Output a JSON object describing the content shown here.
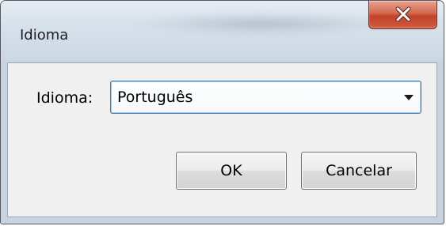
{
  "window": {
    "title": "Idioma",
    "close_icon": "close-x-icon"
  },
  "form": {
    "language_label": "Idioma:",
    "language_value": "Português",
    "dropdown_icon": "chevron-down-icon"
  },
  "buttons": {
    "ok_label": "OK",
    "cancel_label": "Cancelar"
  },
  "colors": {
    "close_button": "#c2432a",
    "focus_border": "#3c7fb1",
    "client_background": "#f0f0f0"
  }
}
